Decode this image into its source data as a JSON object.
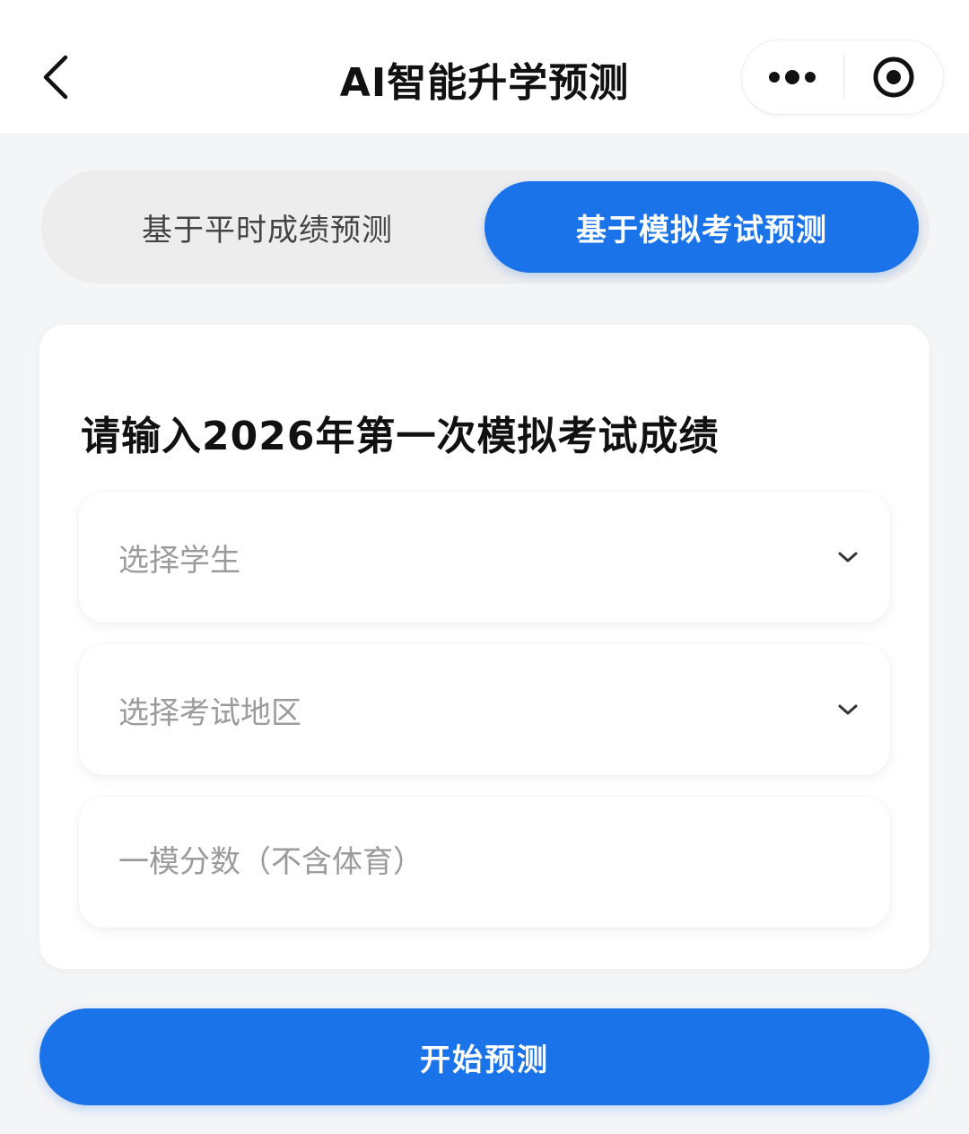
{
  "header": {
    "title": "AI智能升学预测",
    "back_icon": "chevron-left-icon",
    "more_icon": "more-dots-icon",
    "close_icon": "target-close-icon"
  },
  "mode_tabs": {
    "items": [
      {
        "label": "基于平时成绩预测",
        "active": false
      },
      {
        "label": "基于模拟考试预测",
        "active": true
      }
    ]
  },
  "form": {
    "title": "请输入2026年第一次模拟考试成绩",
    "student_select": {
      "placeholder": "选择学生",
      "value": ""
    },
    "region_select": {
      "placeholder": "选择考试地区",
      "value": ""
    },
    "score_input": {
      "placeholder": "一模分数（不含体育）",
      "value": ""
    }
  },
  "start_button": {
    "label": "开始预测"
  },
  "colors": {
    "accent": "#1a73e8",
    "page_bg": "#f4f5f7",
    "placeholder": "#9b9b9b"
  }
}
